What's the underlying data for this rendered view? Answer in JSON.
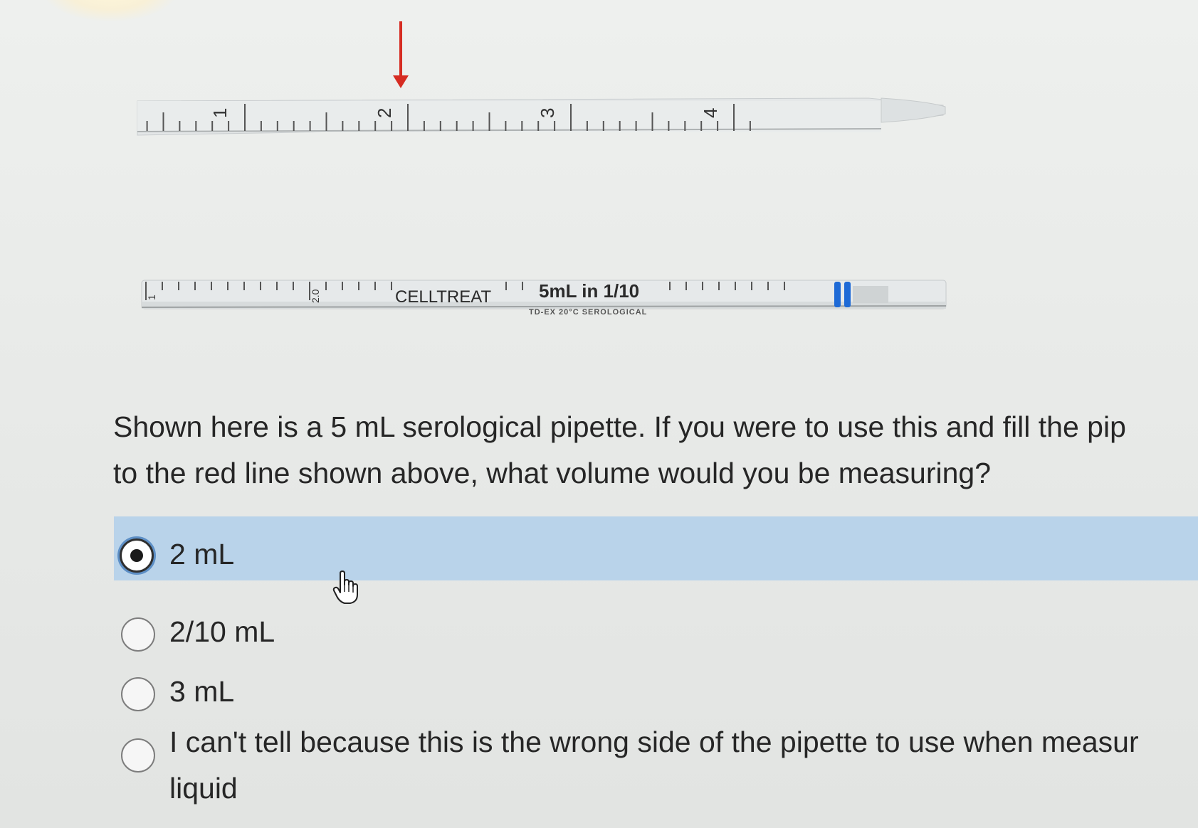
{
  "pipette_top": {
    "labels": [
      "1",
      "2",
      "3",
      "4"
    ],
    "red_arrow_at": "2"
  },
  "pipette_bottom": {
    "small_labels": [
      "1",
      "2.0"
    ],
    "brand": "CELLTREAT",
    "capacity": "5mL in 1/10",
    "fine_print": "TD-EX 20°C SEROLOGICAL"
  },
  "question": {
    "line1": "Shown here is a 5 mL serological pipette.  If you were to use this and fill the pip",
    "line2": "to the red line shown above, what volume would you be measuring?"
  },
  "options": [
    {
      "label": "2 mL",
      "selected": true
    },
    {
      "label": "2/10 mL",
      "selected": false
    },
    {
      "label": "3 mL",
      "selected": false
    },
    {
      "label_line1": "I can't tell because this is the wrong side of the pipette to use when measur",
      "label_line2": "liquid",
      "selected": false
    }
  ],
  "colors": {
    "red_arrow": "#d62c22",
    "selected_row": "#b9d3ea",
    "blue_band": "#1e6ad6"
  }
}
